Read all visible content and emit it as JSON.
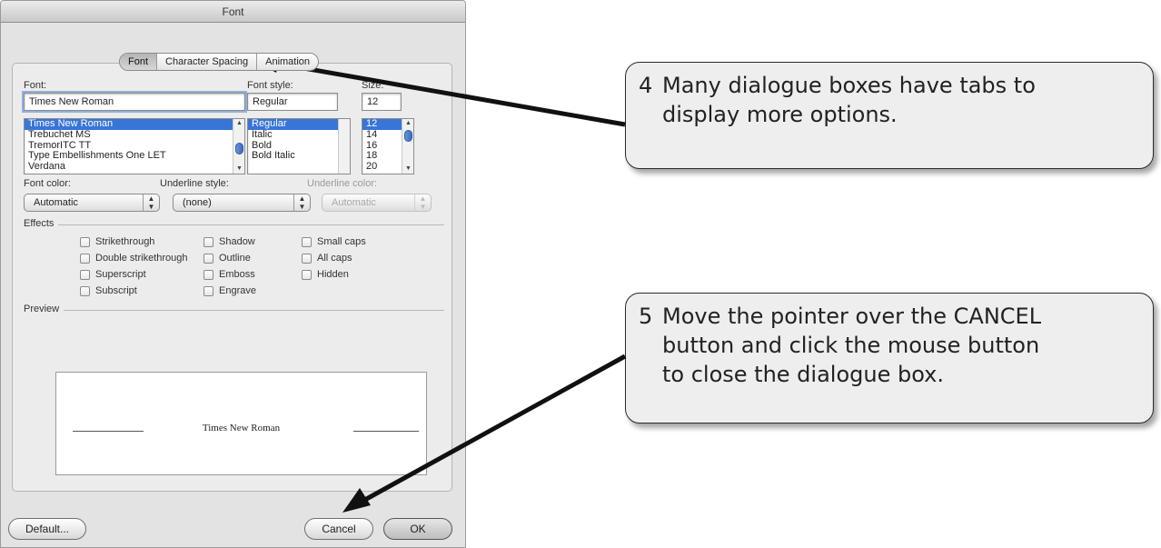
{
  "dialog": {
    "title": "Font",
    "tabs": [
      {
        "label": "Font",
        "active": true
      },
      {
        "label": "Character Spacing",
        "active": false
      },
      {
        "label": "Animation",
        "active": false
      }
    ],
    "font_label": "Font:",
    "font_value": "Times New Roman",
    "font_list": [
      "Times New Roman",
      "Trebuchet MS",
      "TremorITC TT",
      "Type Embellishments One LET",
      "Verdana"
    ],
    "style_label": "Font style:",
    "style_value": "Regular",
    "style_list": [
      "Regular",
      "Italic",
      "Bold",
      "Bold Italic"
    ],
    "size_label": "Size:",
    "size_value": "12",
    "size_list": [
      "12",
      "14",
      "16",
      "18",
      "20"
    ],
    "font_color_label": "Font color:",
    "font_color_value": "Automatic",
    "underline_style_label": "Underline style:",
    "underline_style_value": "(none)",
    "underline_color_label": "Underline color:",
    "underline_color_value": "Automatic",
    "effects_label": "Effects",
    "effects": {
      "col1": [
        "Strikethrough",
        "Double strikethrough",
        "Superscript",
        "Subscript"
      ],
      "col2": [
        "Shadow",
        "Outline",
        "Emboss",
        "Engrave"
      ],
      "col3": [
        "Small caps",
        "All caps",
        "Hidden"
      ]
    },
    "preview_label": "Preview",
    "preview_text": "Times New Roman",
    "buttons": {
      "default": "Default...",
      "cancel": "Cancel",
      "ok": "OK"
    }
  },
  "callouts": [
    {
      "number": "4",
      "lines": [
        "Many dialogue boxes have tabs to",
        "display more options."
      ]
    },
    {
      "number": "5",
      "lines": [
        "Move the pointer over the CANCEL",
        "button and click the mouse button",
        "to close the dialogue box."
      ]
    }
  ]
}
